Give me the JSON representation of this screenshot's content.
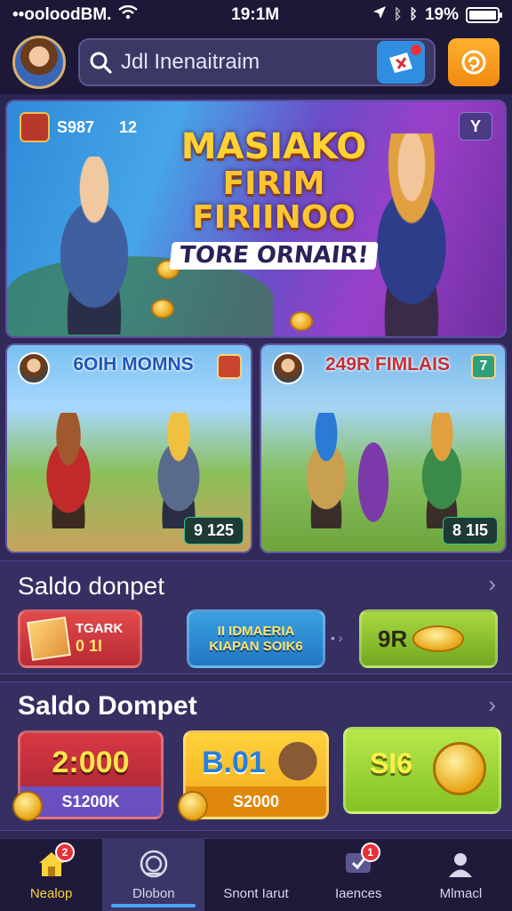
{
  "status_bar": {
    "carrier": "••ooloodBM.",
    "time": "19:1M",
    "battery": "19%"
  },
  "header": {
    "search_text": "Jdl Inenaitraim"
  },
  "hero": {
    "badge_text": "S987",
    "badge_count": "12",
    "corner_label": "Y",
    "title_line1": "MASIAKO",
    "title_line2": "FIRIM FIRIINOO",
    "title_line3": "TORE ORNAIR!"
  },
  "games": [
    {
      "title": "6OIH MOMNS",
      "price": "9 125"
    },
    {
      "title": "249R FIMLAIS",
      "price": "8 1I5",
      "corner": "7"
    }
  ],
  "section1": {
    "title": "Saldo donpet",
    "pill1_line1": "TGARK",
    "pill1_line2": "0 1I",
    "pill2_line1": "II  IDMAERIA",
    "pill2_line2": "KIAPAN SOIK6",
    "pill3_text": "9R"
  },
  "section2": {
    "title": "Saldo Dompet",
    "card1_value": "2:000",
    "card1_footer": "S1200K",
    "card2_value": "B.01",
    "card2_footer": "S2000",
    "card3_value": "SI6"
  },
  "nav": [
    {
      "label": "Nealop",
      "badge": "2"
    },
    {
      "label": "Dlobon"
    },
    {
      "label": "Snont Iarut"
    },
    {
      "label": "Iaences",
      "badge": "1"
    },
    {
      "label": "Mlmacl"
    }
  ],
  "colors": {
    "background": "#2a2450",
    "accent_orange": "#f08a10",
    "accent_blue": "#4da6ff",
    "badge_red": "#e8303a"
  }
}
